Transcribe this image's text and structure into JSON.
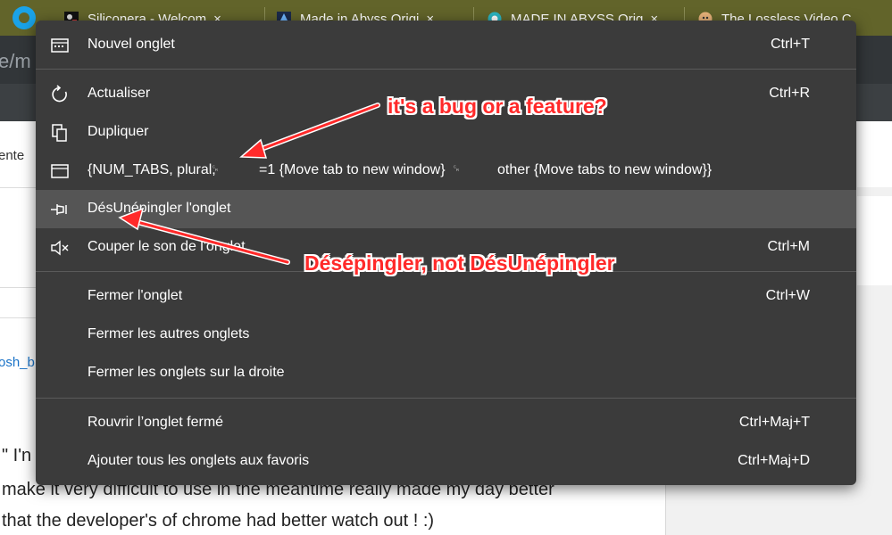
{
  "tabs": [
    {
      "title": "Siliconera - Welcom",
      "close": "×"
    },
    {
      "title": "Made in Abyss Origi",
      "close": "×"
    },
    {
      "title": "MADE IN ABYSS Orig",
      "close": "×"
    },
    {
      "title": "The Lossless Video C",
      "close": ""
    }
  ],
  "address": {
    "text": "e/m"
  },
  "background_page": {
    "left_label": "ente",
    "link_fragment": "osh_b",
    "line1": "\" I'n",
    "line2": "make it very difficult to use in the meantime   really made my day better",
    "line3": "that the developer's of chrome had better watch out ! :)"
  },
  "menu": {
    "new_tab": {
      "label": "Nouvel onglet",
      "shortcut": "Ctrl+T"
    },
    "reload": {
      "label": "Actualiser",
      "shortcut": "Ctrl+R"
    },
    "duplicate": {
      "label": "Dupliquer"
    },
    "move_tab": {
      "part1": "{NUM_TABS, plural,",
      "part2": "=1 {Move tab to new window}",
      "part3": "other {Move tabs to new window}}",
      "glyph": "␍"
    },
    "unpin": {
      "label": "DésUnépingler l'onglet"
    },
    "mute": {
      "label": "Couper le son de l'onglet",
      "shortcut": "Ctrl+M"
    },
    "close_tab": {
      "label": "Fermer l'onglet",
      "shortcut": "Ctrl+W"
    },
    "close_others": {
      "label": "Fermer les autres onglets"
    },
    "close_right": {
      "label": "Fermer les onglets sur la droite"
    },
    "reopen": {
      "label": "Rouvrir l’onglet fermé",
      "shortcut": "Ctrl+Maj+T"
    },
    "bookmark_all": {
      "label": "Ajouter tous les onglets aux favoris",
      "shortcut": "Ctrl+Maj+D"
    }
  },
  "annotations": {
    "bug": "it's a bug or a feature?",
    "unpin_note": "Désépingler, not DésUnépingler",
    "color": "#ff2a2a"
  },
  "colors": {
    "tabstrip": "#62642a",
    "menu_bg": "#3b3b3b",
    "menu_highlight": "#555555",
    "annotation": "#ff2a2a"
  }
}
